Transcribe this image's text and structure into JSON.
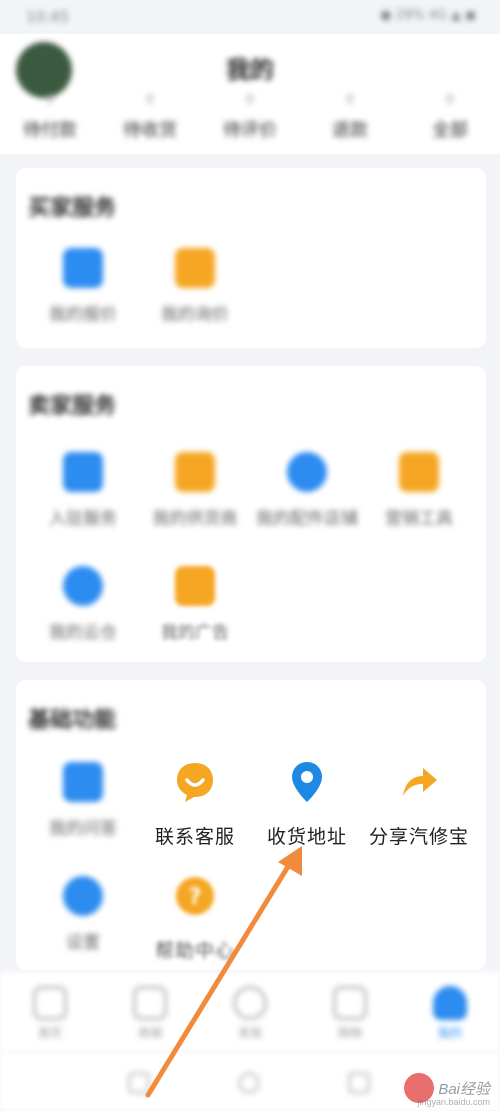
{
  "status_bar": {
    "time": "10:45",
    "right": "● 28% 4G ▲ ◼"
  },
  "header": {
    "title": "我的",
    "stats": [
      {
        "num": "0",
        "label": "待付款"
      },
      {
        "num": "0",
        "label": "待收货"
      },
      {
        "num": "0",
        "label": "待评价"
      },
      {
        "num": "0",
        "label": "退款"
      },
      {
        "num": "0",
        "label": "全部"
      }
    ]
  },
  "section1": {
    "title": "买家服务",
    "items": [
      {
        "label": "我的报价",
        "icon": "document-icon",
        "color": "#2d8cf0"
      },
      {
        "label": "我的询价",
        "icon": "message-icon",
        "color": "#f5a623"
      }
    ]
  },
  "section2": {
    "title": "卖家服务",
    "items": [
      {
        "label": "入驻服务",
        "icon": "store-icon",
        "color": "#2d8cf0"
      },
      {
        "label": "我的供货商",
        "icon": "supplier-icon",
        "color": "#f5a623"
      },
      {
        "label": "我的配件店铺",
        "icon": "shop-icon",
        "color": "#2d8cf0"
      },
      {
        "label": "营销工具",
        "icon": "tools-icon",
        "color": "#f5a623"
      },
      {
        "label": "我的云仓",
        "icon": "cloud-icon",
        "color": "#2d8cf0"
      },
      {
        "label": "我的广告",
        "icon": "ad-icon",
        "color": "#f5a623"
      }
    ]
  },
  "section3": {
    "title": "基础功能",
    "items": [
      {
        "label": "我的问答",
        "icon": "chat-icon",
        "color": "#2d8cf0"
      },
      {
        "label": "联系客服",
        "icon": "customer-service-icon",
        "color": "#f5a623"
      },
      {
        "label": "收货地址",
        "icon": "location-pin-icon",
        "color": "#1e88e5"
      },
      {
        "label": "分享汽修宝",
        "icon": "share-arrow-icon",
        "color": "#f5a623"
      },
      {
        "label": "设置",
        "icon": "settings-icon",
        "color": "#2d8cf0"
      },
      {
        "label": "帮助中心",
        "icon": "help-icon",
        "color": "#f5a623"
      }
    ]
  },
  "tabbar": {
    "tabs": [
      {
        "label": "首页",
        "icon": "home-icon"
      },
      {
        "label": "商城",
        "icon": "grid-icon"
      },
      {
        "label": "发现",
        "icon": "compass-icon"
      },
      {
        "label": "购物",
        "icon": "cart-icon"
      },
      {
        "label": "我的",
        "icon": "person-icon",
        "active": true
      }
    ]
  },
  "annotation": {
    "color": "#f28a3c"
  },
  "watermark": {
    "text": "Bai经验",
    "sub": "jingyan.baidu.com"
  }
}
